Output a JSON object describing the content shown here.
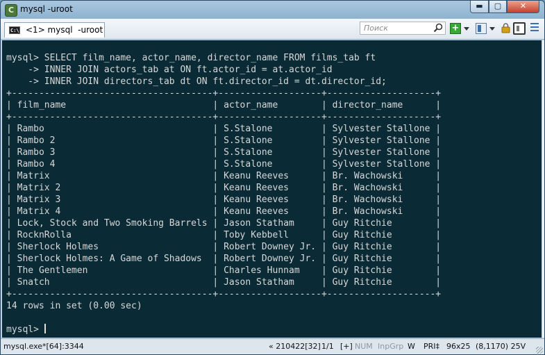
{
  "window": {
    "title": "mysql  -uroot",
    "buttons": {
      "minimize": "▬",
      "maximize": "▢",
      "close": "✕"
    }
  },
  "toolbar": {
    "tab_label": "<1> mysql  -uroot",
    "tab_icon_text": "C:\\",
    "search_placeholder": "Поиск",
    "add_label": "+"
  },
  "console": {
    "prompt": "mysql> ",
    "query_lines": [
      "mysql> SELECT film_name, actor_name, director_name FROM films_tab ft",
      "    -> INNER JOIN actors_tab at ON ft.actor_id = at.actor_id",
      "    -> INNER JOIN directors_tab dt ON ft.director_id = dt.director_id;"
    ],
    "columns": [
      "film_name",
      "actor_name",
      "director_name"
    ],
    "rows": [
      [
        "Rambo",
        "S.Stalone",
        "Sylvester Stallone"
      ],
      [
        "Rambo 2",
        "S.Stalone",
        "Sylvester Stallone"
      ],
      [
        "Rambo 3",
        "S.Stalone",
        "Sylvester Stallone"
      ],
      [
        "Rambo 4",
        "S.Stalone",
        "Sylvester Stallone"
      ],
      [
        "Matrix",
        "Keanu Reeves",
        "Br. Wachowski"
      ],
      [
        "Matrix 2",
        "Keanu Reeves",
        "Br. Wachowski"
      ],
      [
        "Matrix 3",
        "Keanu Reeves",
        "Br. Wachowski"
      ],
      [
        "Matrix 4",
        "Keanu Reeves",
        "Br. Wachowski"
      ],
      [
        "Lock, Stock and Two Smoking Barrels",
        "Jason Statham",
        "Guy Ritchie"
      ],
      [
        "RocknRolla",
        "Toby Kebbell",
        "Guy Ritchie"
      ],
      [
        "Sherlock Holmes",
        "Robert Downey Jr.",
        "Guy Ritchie"
      ],
      [
        "Sherlock Holmes: A Game of Shadows",
        "Robert Downey Jr.",
        "Guy Ritchie"
      ],
      [
        "The Gentlemen",
        "Charles Hunnam",
        "Guy Ritchie"
      ],
      [
        "Snatch",
        "Jason Statham",
        "Guy Ritchie"
      ]
    ],
    "result_summary": "14 rows in set (0.00 sec)"
  },
  "statusbar": {
    "process": "mysql.exe*[64]:3344",
    "position": "« 210422[32]",
    "console_index": "1/1",
    "plus": "[+]",
    "num": "NUM",
    "inpgrp": "InpGrp",
    "w": "W",
    "pri": "PRI‡",
    "size": "96x25",
    "cursor_info": "(8,1170) 25V"
  },
  "colors": {
    "console_bg": "#0a2b36",
    "console_fg": "#d8d8d8",
    "title_bg": "#a9c7de",
    "close_button": "#c4402a"
  },
  "icons": [
    "console-app-icon",
    "search-icon",
    "add-console-icon",
    "window-icon",
    "lock-icon",
    "panel-icon",
    "menu-icon"
  ]
}
